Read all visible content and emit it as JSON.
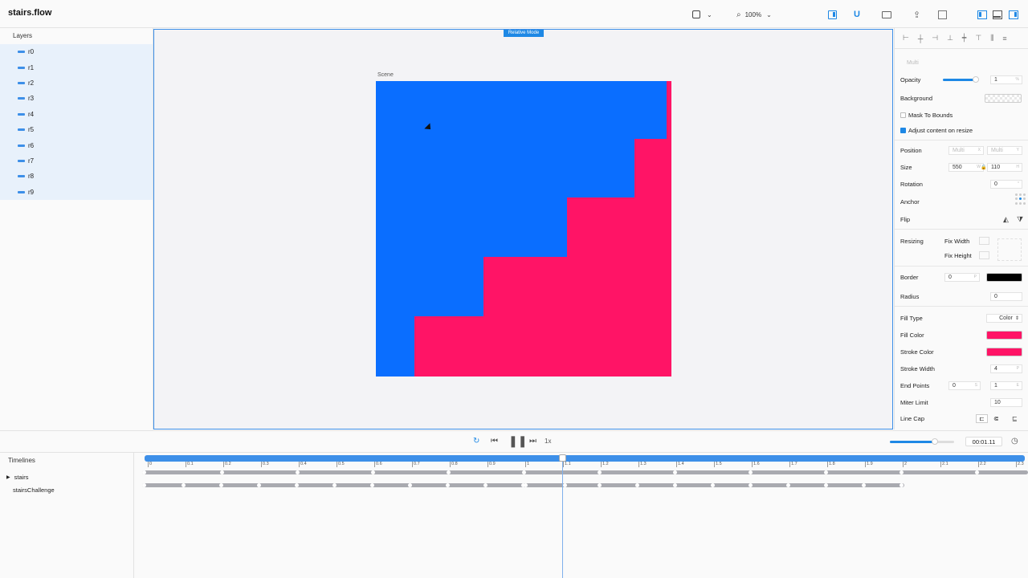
{
  "app": {
    "title": "stairs.flow",
    "zoom": "100%"
  },
  "layers": {
    "title": "Layers",
    "items": [
      "r0",
      "r1",
      "r2",
      "r3",
      "r4",
      "r5",
      "r6",
      "r7",
      "r8",
      "r9"
    ]
  },
  "canvas": {
    "mode_badge": "Relative Mode",
    "scene_label": "Scene",
    "colors": {
      "blue": "#0a6eff",
      "pink": "#ff1466"
    }
  },
  "inspector": {
    "multi_label": "Multi",
    "opacity": {
      "label": "Opacity",
      "value": "1",
      "unit": "%"
    },
    "background_label": "Background",
    "mask_to_bounds": {
      "label": "Mask To Bounds",
      "checked": false
    },
    "adjust_content": {
      "label": "Adjust content on resize",
      "checked": true
    },
    "position": {
      "label": "Position",
      "x": "Multi",
      "x_unit": "X",
      "y": "Multi",
      "y_unit": "Y"
    },
    "size": {
      "label": "Size",
      "w": "550",
      "w_unit": "W",
      "h": "110",
      "h_unit": "H"
    },
    "rotation": {
      "label": "Rotation",
      "value": "0",
      "unit": "°"
    },
    "anchor_label": "Anchor",
    "flip_label": "Flip",
    "resizing": {
      "label": "Resizing",
      "fix_width": "Fix Width",
      "fix_height": "Fix Height"
    },
    "border": {
      "label": "Border",
      "value": "0",
      "unit": "P",
      "color": "#000000"
    },
    "radius": {
      "label": "Radius",
      "value": "0"
    },
    "fill_type": {
      "label": "Fill Type",
      "value": "Color"
    },
    "fill_color": {
      "label": "Fill Color",
      "color": "#ff1466"
    },
    "stroke_color": {
      "label": "Stroke Color",
      "color": "#ff1466"
    },
    "stroke_width": {
      "label": "Stroke Width",
      "value": "4",
      "unit": "P"
    },
    "end_points": {
      "label": "End Points",
      "start": "0",
      "start_unit": "S",
      "end": "1",
      "end_unit": "E"
    },
    "miter_limit": {
      "label": "Miter Limit",
      "value": "10"
    },
    "line_cap": {
      "label": "Line Cap"
    }
  },
  "transport": {
    "speed": "1x",
    "time": "00:01.11"
  },
  "timelines": {
    "header": "Timelines",
    "items": [
      "stairs",
      "stairsChallenge"
    ],
    "ticks": [
      "0",
      "0.1",
      "0.2",
      "0.3",
      "0.4",
      "0.5",
      "0.6",
      "0.7",
      "0.8",
      "0.9",
      "1",
      "1.1",
      "1.2",
      "1.3",
      "1.4",
      "1.5",
      "1.6",
      "1.7",
      "1.8",
      "1.9",
      "2",
      "2.1",
      "2.2",
      "2.3"
    ]
  }
}
